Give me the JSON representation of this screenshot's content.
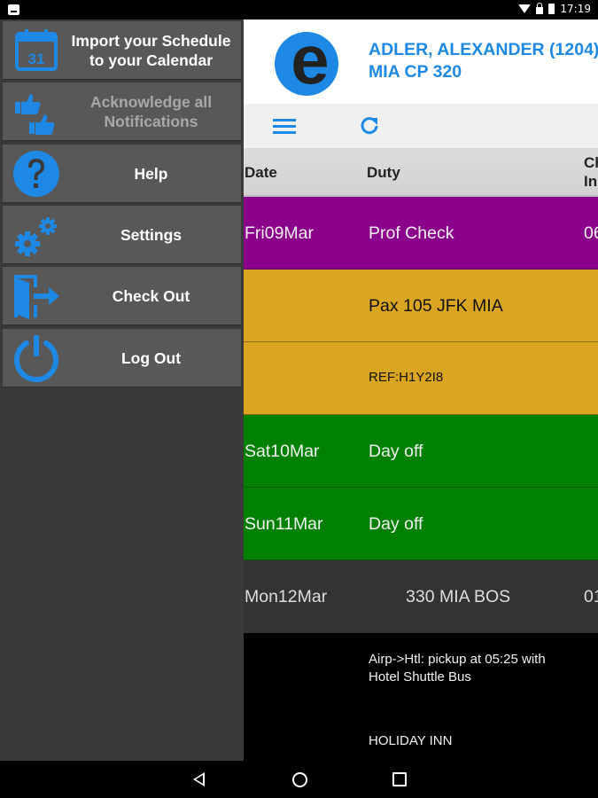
{
  "status_bar": {
    "time": "17:19"
  },
  "drawer": {
    "items": [
      {
        "label": "Import your Schedule\nto your Calendar",
        "icon": "calendar-icon",
        "enabled": true
      },
      {
        "label": "Acknowledge all\nNotifications",
        "icon": "thumbs-up-icon",
        "enabled": false
      },
      {
        "label": "Help",
        "icon": "help-icon",
        "enabled": true
      },
      {
        "label": "Settings",
        "icon": "gears-icon",
        "enabled": true
      },
      {
        "label": "Check Out",
        "icon": "exit-door-icon",
        "enabled": true
      },
      {
        "label": "Log Out",
        "icon": "power-icon",
        "enabled": true
      }
    ],
    "calendar_day": "31"
  },
  "header": {
    "logo_letter": "e",
    "user_name": "ADLER, ALEXANDER (1204)",
    "user_position": "MIA CP 320"
  },
  "table": {
    "columns": [
      "Date",
      "Duty",
      "Ch",
      "In"
    ],
    "rows": [
      {
        "date": "Fri09Mar",
        "duty": "Prof Check",
        "extra": "06",
        "color": "#8b008b",
        "style": "big"
      },
      {
        "date": "",
        "duty": "Pax 105 JFK MIA",
        "extra": "",
        "color": "#daa520",
        "style": "big-dark"
      },
      {
        "date": "",
        "duty": "REF:H1Y2I8",
        "extra": "",
        "color": "#daa520",
        "style": "small-dark"
      },
      {
        "date": "Sat10Mar",
        "duty": "Day off",
        "extra": "",
        "color": "#008000",
        "style": "big"
      },
      {
        "date": "Sun11Mar",
        "duty": "Day off",
        "extra": "",
        "color": "#008000",
        "style": "big"
      },
      {
        "date": "Mon12Mar",
        "duty": "330 MIA BOS",
        "extra": "01",
        "color": "#333333",
        "style": "big-indent"
      },
      {
        "date": "",
        "duty": "Airp->Htl: pickup at 05:25 with\nHotel Shuttle Bus",
        "extra": "",
        "color": "#000000",
        "style": "small"
      },
      {
        "date": "",
        "duty": "HOLIDAY INN",
        "extra": "",
        "color": "#000000",
        "style": "small-bottom"
      }
    ]
  },
  "colors": {
    "accent": "#1e88e5",
    "drawer_bg": "#3a3a3a",
    "menu_item_bg": "#585858"
  }
}
